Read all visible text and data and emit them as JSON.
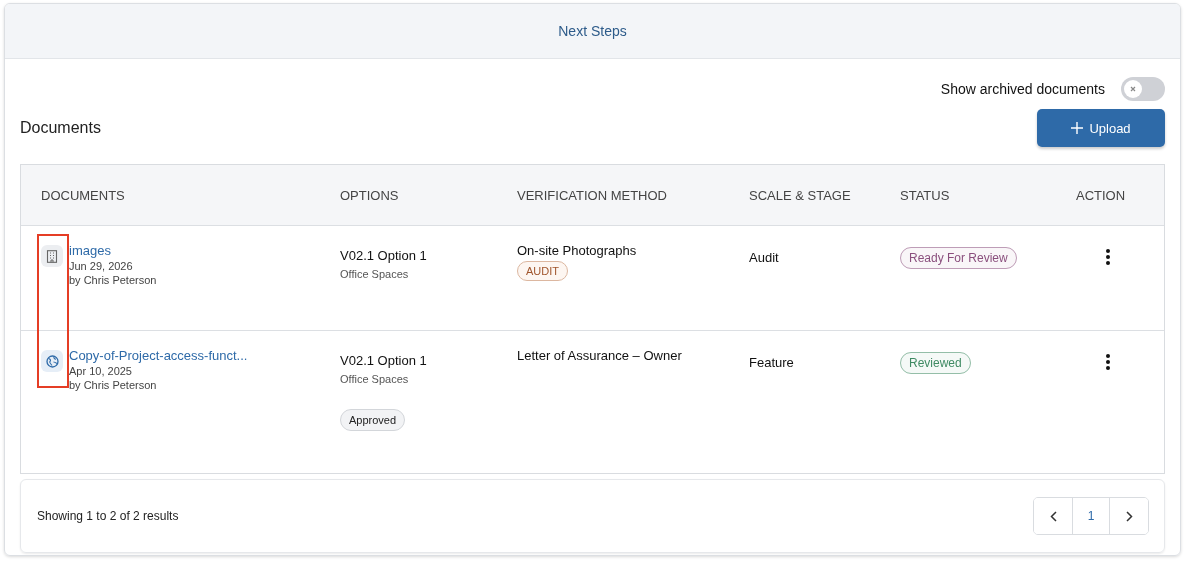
{
  "header": {
    "title": "Next Steps"
  },
  "archive_toggle": {
    "label": "Show archived documents",
    "on": false
  },
  "section": {
    "title": "Documents",
    "upload_button": "Upload"
  },
  "table": {
    "columns": [
      "DOCUMENTS",
      "OPTIONS",
      "VERIFICATION METHOD",
      "SCALE & STAGE",
      "STATUS",
      "ACTION"
    ],
    "rows": [
      {
        "kind": "building",
        "name": "images",
        "date": "Jun 29, 2026",
        "author": "by Chris Peterson",
        "option": "V02.1 Option 1",
        "option_sub": "Office Spaces",
        "method": "On-site Photographs",
        "method_tag": "AUDIT",
        "scale": "Audit",
        "status": "Ready For Review",
        "color": "#8a4f7d"
      },
      {
        "kind": "globe",
        "name": "Copy-of-Project-access-funct...",
        "date": "Apr 10, 2025",
        "author": "by Chris Peterson",
        "option": "V02.1 Option 1",
        "option_sub": "Office Spaces",
        "approval": "Approved",
        "method": "Letter of Assurance – Owner",
        "scale": "Feature",
        "status": "Reviewed",
        "color": "#3f8a63"
      }
    ]
  },
  "footer": {
    "summary": "Showing 1 to 2 of 2 results",
    "pages": [
      {
        "label": "1",
        "selected": true
      }
    ]
  }
}
